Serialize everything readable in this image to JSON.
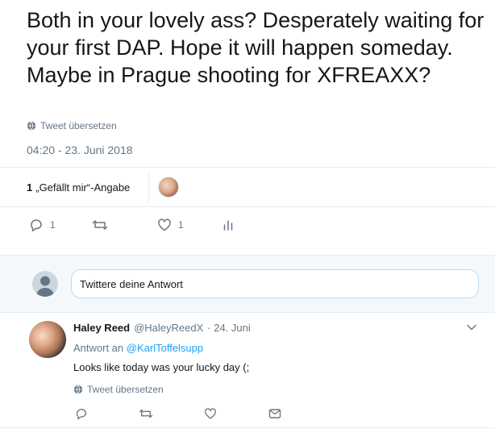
{
  "tweet": {
    "text": "Both in your lovely ass? Desperately waiting for your first DAP. Hope it will happen someday. Maybe in Prague shooting for XFREAXX?",
    "translate_label": "Tweet übersetzen",
    "timestamp": "04:20 - 23. Juni 2018",
    "likes": {
      "count": "1",
      "label": "„Gefällt mir“-Angabe"
    },
    "actions": {
      "reply_count": "1",
      "like_count": "1"
    }
  },
  "reply_box": {
    "placeholder": "Twittere deine Antwort"
  },
  "reply": {
    "name": "Haley Reed",
    "handle": "@HaleyReedX",
    "date": "· 24. Juni",
    "reply_to_prefix": "Antwort an",
    "reply_to_user": "@KarlToffelsupp",
    "text": "Looks like today was your lucky day (;",
    "translate_label": "Tweet übersetzen"
  },
  "colors": {
    "accent": "#1da1f2",
    "secondary_text": "#657786",
    "border": "#e6ecf0"
  },
  "icons": [
    "globe-icon",
    "reply-icon",
    "retweet-icon",
    "heart-icon",
    "analytics-icon",
    "chevron-down-icon",
    "direct-message-icon",
    "default-avatar-icon"
  ]
}
